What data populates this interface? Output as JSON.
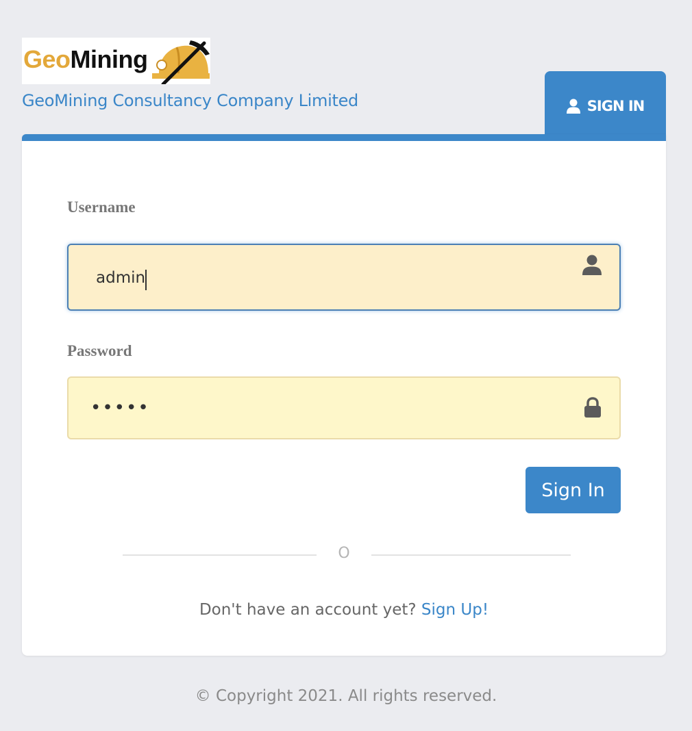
{
  "brand": {
    "logo_geo": "Geo",
    "logo_mining": "Mining",
    "company_name": "GeoMining Consultancy Company Limited",
    "colors": {
      "accent": "#3c87c9",
      "logo_gold": "#e3a83a"
    }
  },
  "tab": {
    "label": "SIGN IN",
    "icon": "user-icon"
  },
  "form": {
    "username_label": "Username",
    "username_value": "admin",
    "username_icon": "user-icon",
    "password_label": "Password",
    "password_value": "admin",
    "password_icon": "lock-icon",
    "submit_label": "Sign In"
  },
  "divider": {
    "text": "O"
  },
  "signup": {
    "prompt": "Don't have an account yet?",
    "link": "Sign Up!"
  },
  "footer": {
    "copyright": "© Copyright 2021. All rights reserved."
  }
}
